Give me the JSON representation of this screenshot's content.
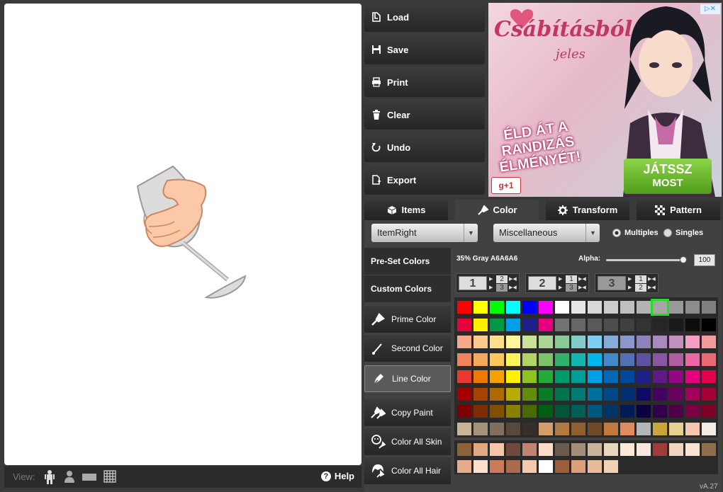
{
  "toolbar": {
    "load": "Load",
    "save": "Save",
    "print": "Print",
    "clear": "Clear",
    "undo": "Undo",
    "export": "Export"
  },
  "ad": {
    "logo": "Csábításból",
    "logo_sub": "jeles",
    "slogan": "ÉLD ÁT A RANDIZÁS ÉLMÉNYÉT!",
    "play_line1": "JÁTSSZ",
    "play_line2": "MOST",
    "gplus": "+1",
    "adx": "▷✕"
  },
  "tabs": [
    "Items",
    "Color",
    "Transform",
    "Pattern"
  ],
  "dropdown_item": "ItemRight",
  "dropdown_category": "Miscellaneous",
  "radio": {
    "multiples": "Multiples",
    "singles": "Singles"
  },
  "side": {
    "preset": "Pre-Set Colors",
    "custom": "Custom Colors",
    "prime": "Prime Color",
    "second": "Second Color",
    "line": "Line Color",
    "copy": "Copy Paint",
    "skin": "Color All Skin",
    "hair": "Color All Hair"
  },
  "color_name": "35% Gray A6A6A6",
  "alpha_label": "Alpha:",
  "alpha_value": "100",
  "slots": [
    {
      "big": "1",
      "a": "2",
      "b": "3"
    },
    {
      "big": "2",
      "a": "1",
      "b": "3"
    },
    {
      "big": "3",
      "a": "1",
      "b": "2"
    }
  ],
  "view_label": "View:",
  "help": "Help",
  "version": "vA.27",
  "palette_rows": [
    [
      "#ff0000",
      "#ffff00",
      "#00ff00",
      "#00ffff",
      "#0000ff",
      "#ff00ff",
      "#ffffff",
      "#e6e6e6",
      "#d9d9d9",
      "#cccccc",
      "#bfbfbf",
      "#b3b3b3",
      "#a6a6a6",
      "#999999",
      "#8c8c8c",
      "#808080"
    ],
    [
      "#e6003c",
      "#ffee00",
      "#009944",
      "#00a0e9",
      "#1d2088",
      "#e4007f",
      "#737373",
      "#666666",
      "#595959",
      "#4d4d4d",
      "#404040",
      "#333333",
      "#262626",
      "#1a1a1a",
      "#0d0d0d",
      "#000000"
    ],
    [
      "#f5a98b",
      "#fbc98e",
      "#fde08d",
      "#fff799",
      "#cce198",
      "#acd598",
      "#89c997",
      "#84ccc9",
      "#7ecef4",
      "#88abda",
      "#8c97cb",
      "#8f82bc",
      "#aa89bd",
      "#c490bf",
      "#f19ec2",
      "#f29c9f"
    ],
    [
      "#ef845c",
      "#f6a95a",
      "#fcc75d",
      "#fff45c",
      "#b3d465",
      "#80c269",
      "#32b16c",
      "#13b5b1",
      "#00b7ee",
      "#448aca",
      "#556fb5",
      "#5f52a0",
      "#8957a1",
      "#ae5da1",
      "#ea68a2",
      "#eb6877"
    ],
    [
      "#e8382f",
      "#ee7800",
      "#f5a200",
      "#fff100",
      "#8fc31f",
      "#22ac38",
      "#009b6b",
      "#009e96",
      "#00a0e9",
      "#0068b7",
      "#00479d",
      "#1d2088",
      "#601986",
      "#920783",
      "#e4007f",
      "#e5004f"
    ],
    [
      "#a40000",
      "#a84200",
      "#ac6a00",
      "#b7aa00",
      "#638c0b",
      "#097c25",
      "#00734f",
      "#007b74",
      "#00709c",
      "#004986",
      "#002e73",
      "#100964",
      "#440062",
      "#6a005f",
      "#a4005b",
      "#a40035"
    ],
    [
      "#7d0000",
      "#7f2d00",
      "#824e00",
      "#8a8000",
      "#486a00",
      "#005e15",
      "#005639",
      "#005e58",
      "#005a7f",
      "#003567",
      "#001c58",
      "#0c0045",
      "#31004a",
      "#500047",
      "#7d0043",
      "#7d0025"
    ],
    [
      "#c9b49a",
      "#a6937c",
      "#806f5c",
      "#59493d",
      "#362e2b",
      "#d39e67",
      "#b07a41",
      "#8f5f2f",
      "#6e4a26",
      "#c07a3e",
      "#e08b5f",
      "#b5b6b7",
      "#c9a63a",
      "#e8d08f",
      "#f5c6b0",
      "#f4ece8"
    ]
  ],
  "skin_rows": [
    [
      "#8c6239",
      "#e2a883",
      "#f5c5a8",
      "#6e4a3e",
      "#c28472",
      "#fddcc8",
      "#6b5a4e",
      "#a38e7a",
      "#c9b39a",
      "#e8d7c0",
      "#fde9d7",
      "#fbe6e0",
      "#9e3d3a",
      "#f3d5bd",
      "#fbe4d3",
      "#8f6e4e"
    ],
    [
      "#e6ad8c",
      "#fde0cf",
      "#c97b5a",
      "#aa6a4d",
      "#f2c9ad",
      "#ffffff",
      "#9b5d3b",
      "#d9a07a",
      "#e8bc9a",
      "#f0d2b4"
    ]
  ]
}
